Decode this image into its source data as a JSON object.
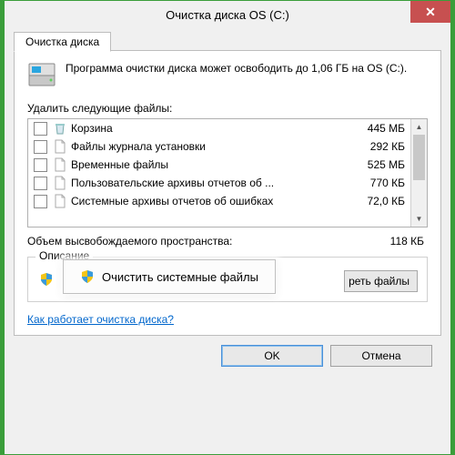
{
  "window": {
    "title": "Очистка диска OS (C:)"
  },
  "tab": {
    "label": "Очистка диска"
  },
  "summary": {
    "text": "Программа очистки диска может освободить до 1,06 ГБ на OS (C:)."
  },
  "delete_label": "Удалить следующие файлы:",
  "files": [
    {
      "name": "Корзина",
      "size": "445 МБ",
      "icon": "recycle"
    },
    {
      "name": "Файлы журнала установки",
      "size": "292 КБ",
      "icon": "file"
    },
    {
      "name": "Временные файлы",
      "size": "525 МБ",
      "icon": "file"
    },
    {
      "name": "Пользовательские архивы отчетов об ...",
      "size": "770 КБ",
      "icon": "file"
    },
    {
      "name": "Системные архивы отчетов об ошибках",
      "size": "72,0 КБ",
      "icon": "file"
    }
  ],
  "total": {
    "label": "Объем высвобождаемого пространства:",
    "value": "118 КБ"
  },
  "description": {
    "label": "Описание"
  },
  "buttons": {
    "clean_system": "Очистить системные файлы",
    "view_files_partial": "реть файлы",
    "ok": "OK",
    "cancel": "Отмена"
  },
  "help_link": "Как работает очистка диска?"
}
